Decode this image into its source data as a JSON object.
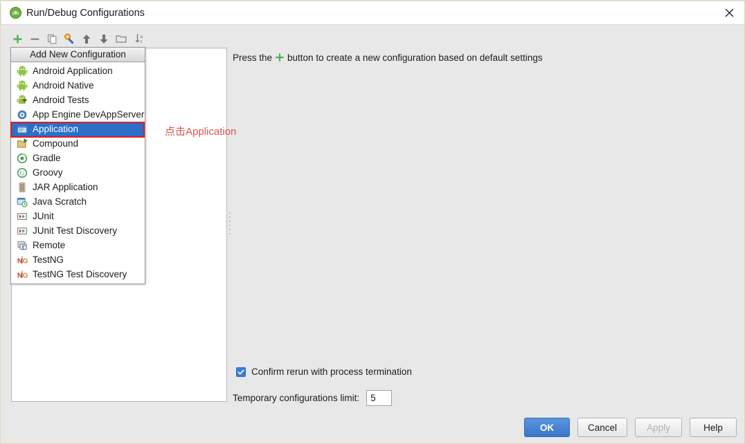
{
  "window": {
    "title": "Run/Debug Configurations",
    "title_icon": "android-studio-icon",
    "close_icon": "close-icon"
  },
  "toolbar": {
    "items": [
      {
        "name": "add-configuration-button",
        "icon": "plus-icon",
        "tooltip": "Add New Configuration"
      },
      {
        "name": "remove-configuration-button",
        "icon": "minus-icon",
        "tooltip": "Remove Configuration"
      },
      {
        "name": "copy-configuration-button",
        "icon": "copy-icon",
        "tooltip": "Copy Configuration"
      },
      {
        "name": "edit-defaults-button",
        "icon": "wrench-icon",
        "tooltip": "Edit defaults"
      },
      {
        "name": "move-up-button",
        "icon": "arrow-up-icon",
        "tooltip": "Move Up"
      },
      {
        "name": "move-down-button",
        "icon": "arrow-down-icon",
        "tooltip": "Move Down"
      },
      {
        "name": "create-folder-button",
        "icon": "folder-icon",
        "tooltip": "Create New Folder"
      },
      {
        "name": "sort-button",
        "icon": "sort-az-icon",
        "tooltip": "Sort Configurations"
      }
    ]
  },
  "popup": {
    "header": "Add New Configuration",
    "items": [
      {
        "label": "Android Application",
        "icon": "android-robot-icon",
        "selected": false
      },
      {
        "label": "Android Native",
        "icon": "android-robot-icon",
        "selected": false
      },
      {
        "label": "Android Tests",
        "icon": "android-tests-icon",
        "selected": false
      },
      {
        "label": "App Engine DevAppServer",
        "icon": "app-engine-icon",
        "selected": false
      },
      {
        "label": "Application",
        "icon": "application-window-icon",
        "selected": true
      },
      {
        "label": "Compound",
        "icon": "compound-folder-icon",
        "selected": false
      },
      {
        "label": "Gradle",
        "icon": "gradle-icon",
        "selected": false
      },
      {
        "label": "Groovy",
        "icon": "groovy-icon",
        "selected": false
      },
      {
        "label": "JAR Application",
        "icon": "jar-icon",
        "selected": false
      },
      {
        "label": "Java Scratch",
        "icon": "java-scratch-icon",
        "selected": false
      },
      {
        "label": "JUnit",
        "icon": "junit-icon",
        "selected": false
      },
      {
        "label": "JUnit Test Discovery",
        "icon": "junit-icon",
        "selected": false
      },
      {
        "label": "Remote",
        "icon": "remote-icon",
        "selected": false
      },
      {
        "label": "TestNG",
        "icon": "testng-icon",
        "selected": false
      },
      {
        "label": "TestNG Test Discovery",
        "icon": "testng-icon",
        "selected": false
      }
    ]
  },
  "annotation": {
    "text": "点击Application",
    "color": "#d9544d",
    "box_color": "#e01b1b"
  },
  "main": {
    "hint_before": "Press the",
    "hint_after": "button to create a new configuration based on default settings",
    "confirm_label": "Confirm rerun with process termination",
    "confirm_checked": true,
    "temp_limit_label": "Temporary configurations limit:",
    "temp_limit_value": "5"
  },
  "buttons": {
    "ok": "OK",
    "cancel": "Cancel",
    "apply": "Apply",
    "help": "Help",
    "apply_enabled": false
  },
  "colors": {
    "selection_blue": "#2b6fc9",
    "primary_button": "#3a76c9",
    "accent_green": "#4caf50"
  }
}
